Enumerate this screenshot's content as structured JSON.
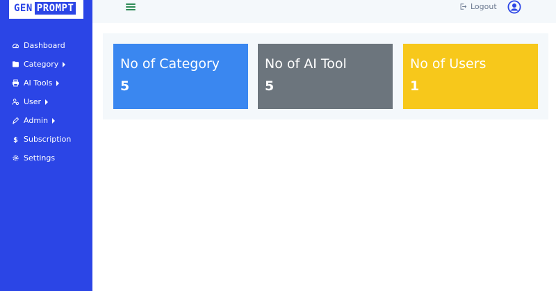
{
  "brand": {
    "part1": "GEN",
    "part2": "PROMPT"
  },
  "sidebar": {
    "items": [
      {
        "label": "Dashboard",
        "icon": "dashboard-icon",
        "has_caret": false
      },
      {
        "label": "Category",
        "icon": "folder-icon",
        "has_caret": true
      },
      {
        "label": "AI Tools",
        "icon": "printer-icon",
        "has_caret": true
      },
      {
        "label": "User",
        "icon": "users-icon",
        "has_caret": true
      },
      {
        "label": "Admin",
        "icon": "pencil-icon",
        "has_caret": true
      },
      {
        "label": "Subscription",
        "icon": "dollar-icon",
        "has_caret": false
      },
      {
        "label": "Settings",
        "icon": "gear-icon",
        "has_caret": false
      }
    ]
  },
  "header": {
    "logout_label": "Logout"
  },
  "cards": [
    {
      "title": "No of Category",
      "value": "5",
      "color": "#3a87f0"
    },
    {
      "title": "No of AI Tool",
      "value": "5",
      "color": "#6c757d"
    },
    {
      "title": "No of Users",
      "value": "1",
      "color": "#f7c81b"
    }
  ],
  "colors": {
    "sidebar": "#2b45e6",
    "hamburger": "#2e8b57",
    "topbar": "#f4f8fb"
  }
}
